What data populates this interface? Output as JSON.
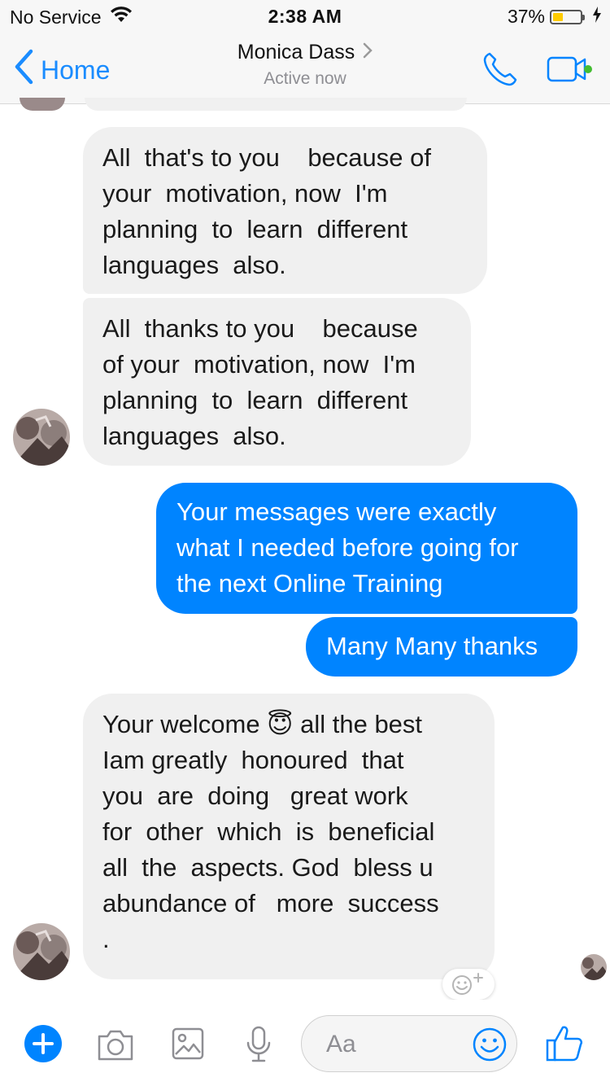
{
  "status_bar": {
    "carrier": "No Service",
    "time": "2:38 AM",
    "battery_percent": "37%",
    "battery_level": 0.37
  },
  "nav": {
    "back_label": "Home",
    "contact_name": "Monica Dass",
    "contact_status": "Active now"
  },
  "messages": [
    {
      "direction": "incoming",
      "text": "All  that's to you    because of\nyour  motivation, now  I'm\nplanning  to  learn  different\nlanguages  also."
    },
    {
      "direction": "incoming",
      "text": "All  thanks to you    because\nof your  motivation, now  I'm\nplanning  to  learn  different\nlanguages  also."
    },
    {
      "direction": "outgoing",
      "text": "Your messages were exactly\nwhat I needed before going for\nthe next Online Training"
    },
    {
      "direction": "outgoing",
      "text": "Many Many thanks"
    },
    {
      "direction": "incoming",
      "text": "Your welcome 😇 all the best\nIam greatly  honoured  that\nyou  are  doing   great work\nfor  other  which  is  beneficial\nall  the  aspects. God  bless u\nabundance of   more  success\n."
    }
  ],
  "composer": {
    "placeholder": "Aa"
  },
  "colors": {
    "accent": "#0084ff",
    "link": "#1a8cff",
    "incoming_bubble": "#f0f0f0",
    "active_dot": "#44bd32",
    "battery": "#ffcc00"
  },
  "icons": [
    "wifi-icon",
    "battery-icon",
    "charging-bolt-icon",
    "back-chevron-icon",
    "chevron-right-icon",
    "phone-icon",
    "video-camera-icon",
    "plus-icon",
    "camera-icon",
    "gallery-icon",
    "microphone-icon",
    "emoji-icon",
    "thumbs-up-icon",
    "add-reaction-icon"
  ]
}
